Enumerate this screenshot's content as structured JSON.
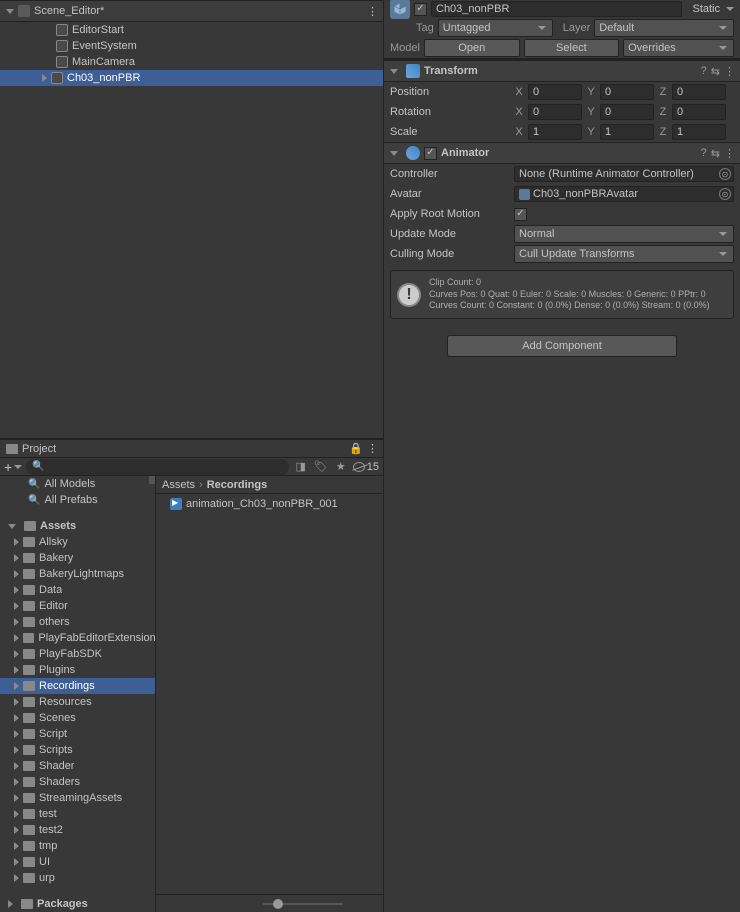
{
  "hierarchy": {
    "scene": "Scene_Editor*",
    "items": [
      "EditorStart",
      "EventSystem",
      "MainCamera",
      "Ch03_nonPBR"
    ],
    "selected_index": 3
  },
  "inspector": {
    "name": "Ch03_nonPBR",
    "static_label": "Static",
    "tag_label": "Tag",
    "tag_value": "Untagged",
    "layer_label": "Layer",
    "layer_value": "Default",
    "model_label": "Model",
    "open_label": "Open",
    "select_label": "Select",
    "overrides_label": "Overrides"
  },
  "transform": {
    "header": "Transform",
    "position_label": "Position",
    "rotation_label": "Rotation",
    "scale_label": "Scale",
    "position": {
      "x": "0",
      "y": "0",
      "z": "0"
    },
    "rotation": {
      "x": "0",
      "y": "0",
      "z": "0"
    },
    "scale": {
      "x": "1",
      "y": "1",
      "z": "1"
    }
  },
  "animator": {
    "header": "Animator",
    "controller_label": "Controller",
    "controller_value": "None (Runtime Animator Controller)",
    "avatar_label": "Avatar",
    "avatar_value": "Ch03_nonPBRAvatar",
    "rootmotion_label": "Apply Root Motion",
    "updatemode_label": "Update Mode",
    "updatemode_value": "Normal",
    "cullingmode_label": "Culling Mode",
    "cullingmode_value": "Cull Update Transforms",
    "info_line1": "Clip Count: 0",
    "info_line2": "Curves Pos: 0 Quat: 0 Euler: 0 Scale: 0 Muscles: 0 Generic: 0 PPtr: 0",
    "info_line3": "Curves Count: 0 Constant: 0 (0.0%) Dense: 0 (0.0%) Stream: 0 (0.0%)"
  },
  "add_component": "Add Component",
  "project": {
    "tab": "Project",
    "hidden_count": "15",
    "favorites": [
      "All Models",
      "All Prefabs"
    ],
    "assets_header": "Assets",
    "folders": [
      "Allsky",
      "Bakery",
      "BakeryLightmaps",
      "Data",
      "Editor",
      "others",
      "PlayFabEditorExtensions",
      "PlayFabSDK",
      "Plugins",
      "Recordings",
      "Resources",
      "Scenes",
      "Script",
      "Scripts",
      "Shader",
      "Shaders",
      "StreamingAssets",
      "test",
      "test2",
      "tmp",
      "UI",
      "urp"
    ],
    "selected_folder_index": 9,
    "packages_header": "Packages",
    "breadcrumb_root": "Assets",
    "breadcrumb_current": "Recordings",
    "asset_item": "animation_Ch03_nonPBR_001"
  }
}
